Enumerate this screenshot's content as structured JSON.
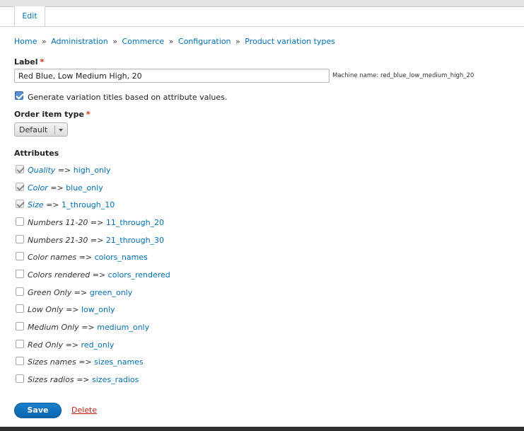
{
  "tabs": {
    "edit_label": "Edit"
  },
  "breadcrumb": {
    "items": [
      "Home",
      "Administration",
      "Commerce",
      "Configuration",
      "Product variation types"
    ],
    "separator": "»"
  },
  "form": {
    "label_field": {
      "label": "Label",
      "required_mark": "*",
      "value": "Red Blue, Low Medium High, 20",
      "machine_name": "Machine name: red_blue_low_medium_high_20"
    },
    "generate_titles": {
      "label": "Generate variation titles based on attribute values.",
      "checked": true
    },
    "order_item_type": {
      "label": "Order item type",
      "required_mark": "*",
      "selected": "Default"
    },
    "attributes": {
      "heading": "Attributes",
      "items": [
        {
          "name": "Quality",
          "machine": "high_only",
          "checked": true,
          "disabled": true
        },
        {
          "name": "Color",
          "machine": "blue_only",
          "checked": true,
          "disabled": true
        },
        {
          "name": "Size",
          "machine": "1_through_10",
          "checked": true,
          "disabled": true
        },
        {
          "name": "Numbers 11-20",
          "machine": "11_through_20",
          "checked": false,
          "disabled": false
        },
        {
          "name": "Numbers 21-30",
          "machine": "21_through_30",
          "checked": false,
          "disabled": false
        },
        {
          "name": "Color names",
          "machine": "colors_names",
          "checked": false,
          "disabled": false
        },
        {
          "name": "Colors rendered",
          "machine": "colors_rendered",
          "checked": false,
          "disabled": false
        },
        {
          "name": "Green Only",
          "machine": "green_only",
          "checked": false,
          "disabled": false
        },
        {
          "name": "Low Only",
          "machine": "low_only",
          "checked": false,
          "disabled": false
        },
        {
          "name": "Medium Only",
          "machine": "medium_only",
          "checked": false,
          "disabled": false
        },
        {
          "name": "Red Only",
          "machine": "red_only",
          "checked": false,
          "disabled": false
        },
        {
          "name": "Sizes names",
          "machine": "sizes_names",
          "checked": false,
          "disabled": false
        },
        {
          "name": "Sizes radios",
          "machine": "sizes_radios",
          "checked": false,
          "disabled": false
        }
      ],
      "arrow": "=>"
    }
  },
  "actions": {
    "save_label": "Save",
    "delete_label": "Delete"
  },
  "colors": {
    "link": "#0071b3",
    "primary_button": "#0a64ae",
    "danger": "#c4261a",
    "required": "#e32700"
  }
}
